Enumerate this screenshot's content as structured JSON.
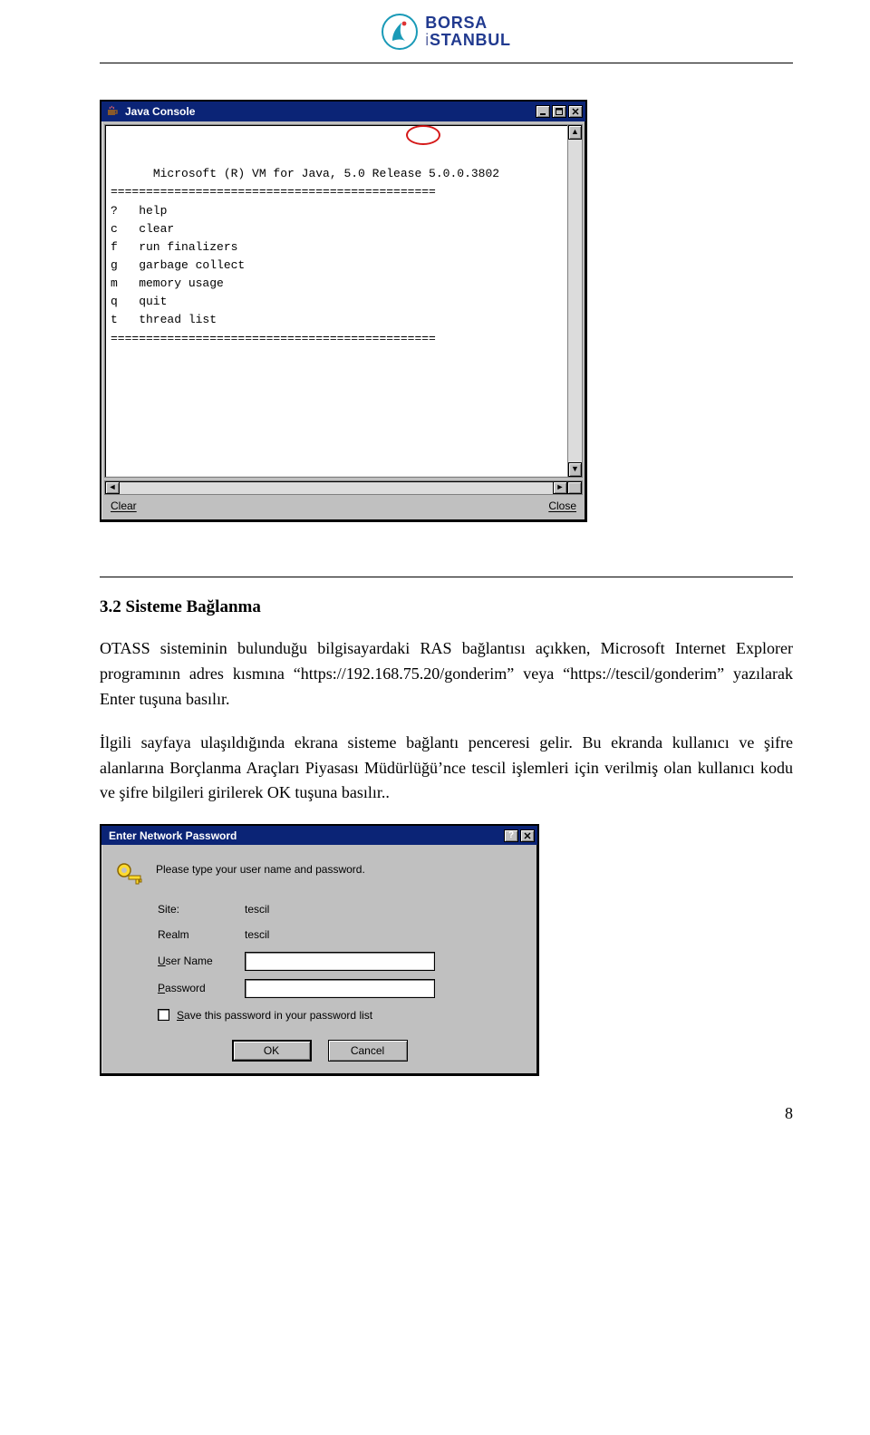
{
  "brand": {
    "line1": "BORSA",
    "line2a": "i",
    "line2b": "STANBUL"
  },
  "page_number": "8",
  "java_console": {
    "title": "Java Console",
    "line_top": "Microsoft (R) VM for Java, 5.0 Release 5.0.0.3802",
    "sep": "==============================================",
    "help_keys": [
      [
        "?",
        "help"
      ],
      [
        "c",
        "clear"
      ],
      [
        "f",
        "run finalizers"
      ],
      [
        "g",
        "garbage collect"
      ],
      [
        "m",
        "memory usage"
      ],
      [
        "q",
        "quit"
      ],
      [
        "t",
        "thread list"
      ]
    ],
    "btn_clear": "Clear",
    "btn_close": "Close"
  },
  "heading": "3.2  Sisteme Bağlanma",
  "para1": "OTASS sisteminin bulunduğu bilgisayardaki RAS bağlantısı açıkken, Microsoft Internet Explorer programının adres kısmına “https://192.168.75.20/gonderim” veya “https://tescil/gonderim”  yazılarak Enter tuşuna basılır.",
  "para2": "İlgili sayfaya ulaşıldığında ekrana sisteme bağlantı penceresi gelir.  Bu ekranda kullanıcı ve şifre alanlarına Borçlanma Araçları Piyasası Müdürlüğü’nce tescil işlemleri için  verilmiş olan kullanıcı kodu ve şifre bilgileri girilerek  OK tuşuna basılır..",
  "dialog": {
    "title": "Enter Network Password",
    "message": "Please type your user name and password.",
    "site_label": "Site:",
    "site_value": "tescil",
    "realm_label": "Realm",
    "realm_value": "tescil",
    "user_label_pre": "",
    "user_label_u": "U",
    "user_label_post": "ser Name",
    "pass_label_pre": "",
    "pass_label_u": "P",
    "pass_label_post": "assword",
    "save_label_pre": "",
    "save_label_u": "S",
    "save_label_post": "ave this password in your password list",
    "ok": "OK",
    "cancel": "Cancel"
  }
}
